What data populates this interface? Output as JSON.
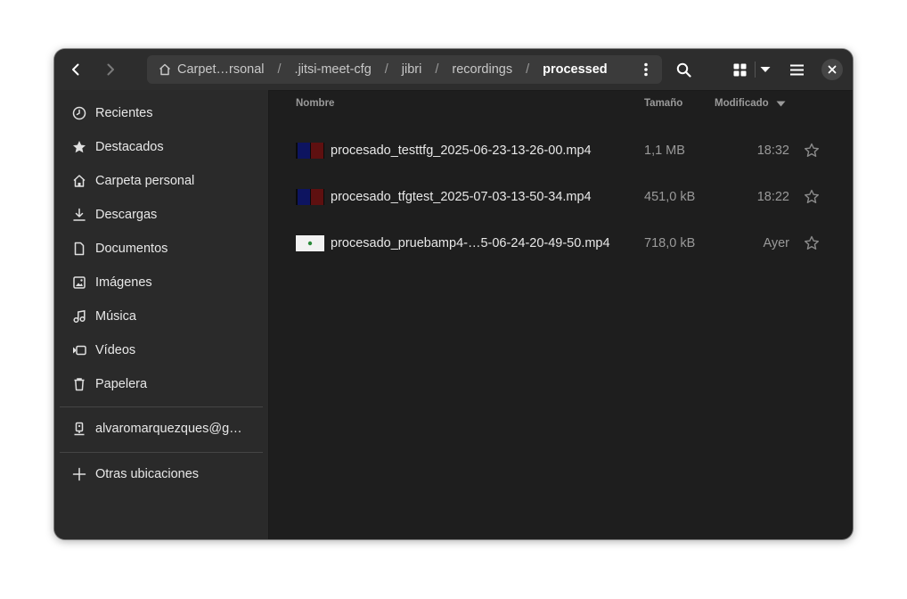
{
  "pathbar": {
    "crumbs": [
      "Carpet…rsonal",
      ".jitsi-meet-cfg",
      "jibri",
      "recordings",
      "processed"
    ],
    "separator": "/"
  },
  "sidebar": {
    "items": [
      {
        "label": "Recientes",
        "icon": "clock-icon"
      },
      {
        "label": "Destacados",
        "icon": "star-icon"
      },
      {
        "label": "Carpeta personal",
        "icon": "home-icon"
      },
      {
        "label": "Descargas",
        "icon": "download-icon"
      },
      {
        "label": "Documentos",
        "icon": "document-icon"
      },
      {
        "label": "Imágenes",
        "icon": "image-icon"
      },
      {
        "label": "Música",
        "icon": "music-icon"
      },
      {
        "label": "Vídeos",
        "icon": "video-icon"
      },
      {
        "label": "Papelera",
        "icon": "trash-icon"
      }
    ],
    "network": {
      "label": "alvaromarquezques@g…",
      "icon": "network-drive-icon"
    },
    "other": {
      "label": "Otras ubicaciones",
      "icon": "plus-icon"
    }
  },
  "columns": {
    "name": "Nombre",
    "size": "Tamaño",
    "modified": "Modificado",
    "sort_icon": "sort-descending-icon"
  },
  "files": [
    {
      "name": "procesado_testtfg_2025-06-23-13-26-00.mp4",
      "size": "1,1 MB",
      "modified": "18:32",
      "thumb": "dark-video"
    },
    {
      "name": "procesado_tfgtest_2025-07-03-13-50-34.mp4",
      "size": "451,0 kB",
      "modified": "18:22",
      "thumb": "dark-video"
    },
    {
      "name": "procesado_pruebamp4-…5-06-24-20-49-50.mp4",
      "size": "718,0 kB",
      "modified": "Ayer",
      "thumb": "light-video"
    }
  ],
  "colors": {
    "accent_bg": "#1e1e1e",
    "sidebar_bg": "#2a2a2a",
    "headerbar_bg": "#2d2d2d",
    "text": "#e8e8e8",
    "muted": "#9a9a9a"
  }
}
